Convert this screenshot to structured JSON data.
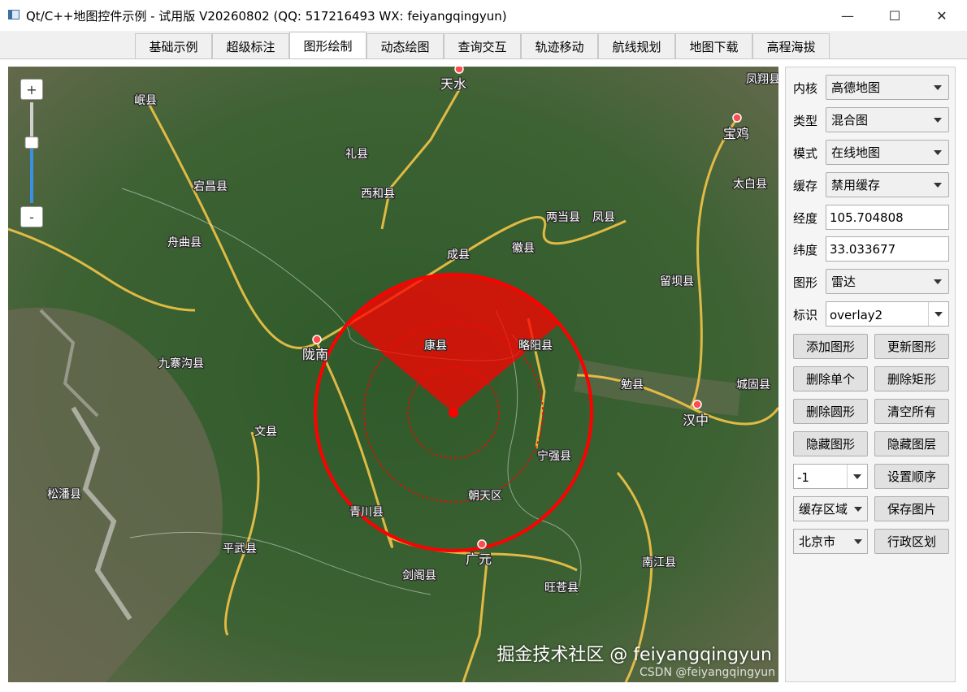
{
  "window": {
    "title": "Qt/C++地图控件示例 - 试用版 V20260802 (QQ: 517216493 WX: feiyangqingyun)",
    "minimize": "—",
    "maximize": "☐",
    "close": "✕"
  },
  "tabs": [
    "基础示例",
    "超级标注",
    "图形绘制",
    "动态绘图",
    "查询交互",
    "轨迹移动",
    "航线规划",
    "地图下载",
    "高程海拔"
  ],
  "active_tab": "图形绘制",
  "map": {
    "zoom_in": "+",
    "zoom_out": "-",
    "zoom_level": 0.6,
    "places": [
      "岷县",
      "天水",
      "凤翔县",
      "宝鸡",
      "礼县",
      "宕昌县",
      "西和县",
      "太白县",
      "两当县",
      "凤县",
      "舟曲县",
      "徽县",
      "成县",
      "留坝县",
      "陇南",
      "康县",
      "略阳县",
      "九寨沟县",
      "勉县",
      "城固县",
      "汉中",
      "文县",
      "宁强县",
      "松潘县",
      "朝天区",
      "青川县",
      "平武县",
      "广元",
      "南江县",
      "剑阁县",
      "旺苍县"
    ],
    "radar_color": "#ff0000",
    "radar_sweep_from_deg": 220,
    "radar_sweep_to_deg": 320
  },
  "panel": {
    "kernel_label": "内核",
    "kernel_value": "高德地图",
    "type_label": "类型",
    "type_value": "混合图",
    "mode_label": "模式",
    "mode_value": "在线地图",
    "cache_label": "缓存",
    "cache_value": "禁用缓存",
    "lng_label": "经度",
    "lng_value": "105.704808",
    "lat_label": "纬度",
    "lat_value": "33.033677",
    "shape_label": "图形",
    "shape_value": "雷达",
    "id_label": "标识",
    "id_value": "overlay2",
    "buttons": {
      "add_shape": "添加图形",
      "update_shape": "更新图形",
      "delete_single": "删除单个",
      "delete_rect": "删除矩形",
      "delete_circle": "删除圆形",
      "clear_all": "清空所有",
      "hide_shape": "隐藏图形",
      "hide_layer": "隐藏图层",
      "set_order": "设置顺序",
      "save_image": "保存图片",
      "admin_area": "行政区划"
    },
    "order_value": "-1",
    "cache_area_value": "缓存区域",
    "city_value": "北京市"
  },
  "watermark": "掘金技术社区 @ feiyangqingyun",
  "watermark_small": "CSDN @feiyangqingyun"
}
